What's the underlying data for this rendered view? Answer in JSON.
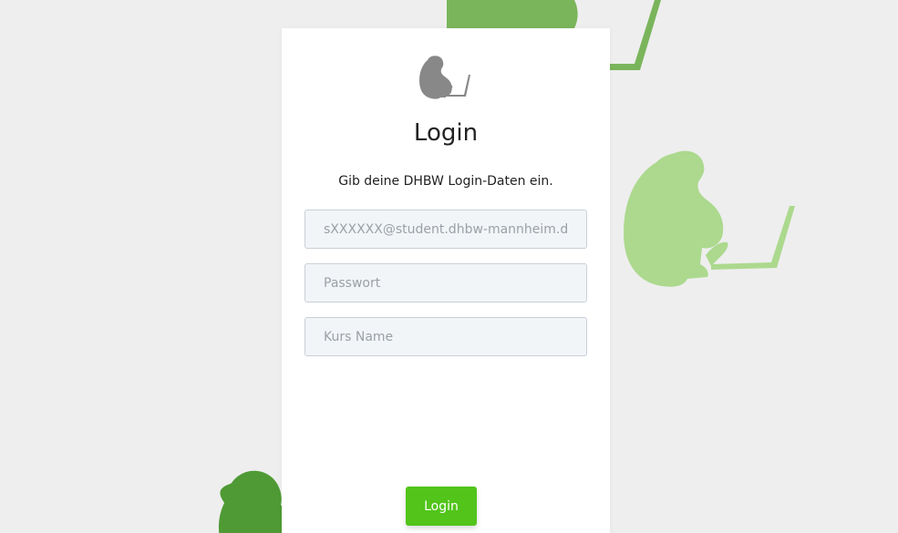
{
  "colors": {
    "background": "#eeeeee",
    "card": "#ffffff",
    "accent": "#52c41a",
    "monkey_dark": "#7ab55c",
    "monkey_light": "#acd98e",
    "monkey_deep": "#4f9a34",
    "logo": "#888888"
  },
  "login": {
    "logo_icon": "monkey-laptop-icon",
    "title": "Login",
    "subtitle": "Gib deine DHBW Login-Daten ein.",
    "email_placeholder": "sXXXXXX@student.dhbw-mannheim.de",
    "password_placeholder": "Passwort",
    "course_placeholder": "Kurs Name",
    "button_label": "Login"
  },
  "decorations": [
    "monkey-laptop-icon",
    "monkey-laptop-icon",
    "monkey-icon"
  ]
}
